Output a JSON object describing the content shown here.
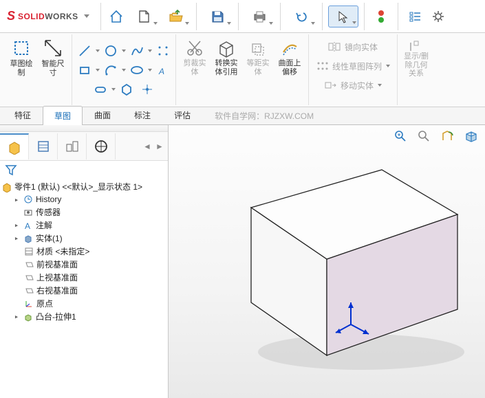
{
  "app": {
    "brand_s": "S",
    "brand_solid": "SOLID",
    "brand_works": "WORKS"
  },
  "ribbon": {
    "sketch_draw": "草图绘\n制",
    "smart_dim": "智能尺\n寸",
    "trim": "剪裁实\n体",
    "convert": "转换实\n体引用",
    "offset_ent": "等距实\n体",
    "offset_surf": "曲面上\n偏移",
    "mirror": "镜向实体",
    "pattern": "线性草图阵列",
    "move": "移动实体",
    "display": "显示/删\n除几何\n关系"
  },
  "tabs": [
    "特征",
    "草图",
    "曲面",
    "标注",
    "评估"
  ],
  "watermark": "软件自学网：RJZXW.COM",
  "tree": {
    "root": "零件1 (默认) <<默认>_显示状态 1>",
    "history": "History",
    "sensors": "传感器",
    "annotations": "注解",
    "bodies": "实体(1)",
    "material": "材质 <未指定>",
    "front": "前视基准面",
    "top": "上视基准面",
    "right": "右视基准面",
    "origin": "原点",
    "extrude": "凸台-拉伸1"
  }
}
